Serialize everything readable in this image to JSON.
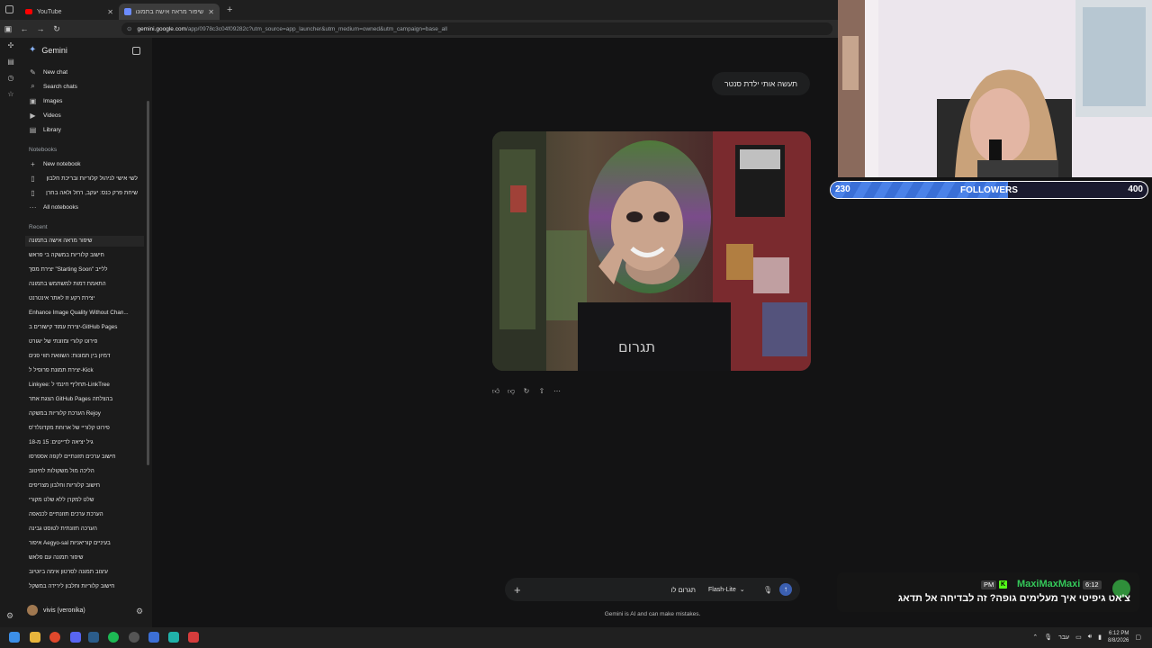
{
  "browser": {
    "tabs": [
      {
        "label": "YouTube",
        "active": false
      },
      {
        "label": "שיפור מראה אישה בתמונה - Ge",
        "active": true
      }
    ],
    "url_domain": "gemini.google.com",
    "url_path": "/app/0978c3c04f09282c?utm_source=app_launcher&utm_medium=owned&utm_campaign=base_all"
  },
  "sidebar": {
    "brand": "Gemini",
    "items": [
      {
        "label": "New chat",
        "icon": "edit-icon"
      },
      {
        "label": "Search chats",
        "icon": "search-icon"
      },
      {
        "label": "Images",
        "icon": "image-icon"
      },
      {
        "label": "Videos",
        "icon": "video-icon"
      },
      {
        "label": "Library",
        "icon": "library-icon"
      }
    ],
    "notebooks_heading": "Notebooks",
    "notebooks": [
      {
        "label": "New notebook",
        "icon": "plus-icon"
      },
      {
        "label": "לשי אישי לניהול קלוריות ובריכת חלבון",
        "icon": "notebook-icon"
      },
      {
        "label": "שיחת פרק כנס: יעקב, רחל ולאה בחרן",
        "icon": "notebook-icon"
      },
      {
        "label": "All notebooks",
        "icon": "more-icon"
      }
    ],
    "recent_heading": "Recent",
    "recent": [
      "שיפור מראה אישה בתמונה",
      "חישוב קלוריות במשקה בי פראש",
      "יצירת מסך \"Starting Soon\" ללייב",
      "התאמת דמות למשתמש בתמונה",
      "יצירת רקע זז לאתר אינטרנט",
      "Enhance Image Quality Without Chan...",
      "יצירת עמוד קישורים ב-GitHub Pages",
      "פירוט קלורי ומזונתי של יוגורט",
      "דמיון בין תמונות: השוואת תווי פנים",
      "יצירת תמונת פרופיל ל-Kick",
      "Linkyee: תחליף חינמי ל-LinkTree",
      "הצגת אתר GitHub Pages בהצלחה",
      "הערכת קלוריות במשקה Rejoy",
      "פירוט קלוריי של ארוחת מקדונלד'ס",
      "גיל יציאה לדייטים: 15 מ-18",
      "חישוב ערכים תזונתיים לקפה אספרסו",
      "הליכה מול משקולות לחיטוב",
      "חישוב קלוריות וחלבון מצריפים",
      "שלט למקרן ללא שלט מקורי",
      "הערכת ערכים תזונתיים לכנאפה",
      "הערכה תזונתית לטוסט גבינה",
      "איפור Aegyo-sal בעיניים קוריאניות",
      "שיפור תמונה עם פלאש",
      "עיצוב תמונה לסרטון אימה ביוטיוב",
      "חישוב קלוריות וחלבון לירידה במשקל"
    ],
    "user_name": "vivis (veronika)"
  },
  "main": {
    "prompt": "תעשה אותי ילדת סנטר",
    "image_alt": "punk girl with green and purple hair in graffiti alley",
    "composer_placeholder": "תגרום לו",
    "model": "Flash-Lite",
    "disclaimer": "Gemini is AI and can make mistakes."
  },
  "overlay": {
    "followers_label": "FOLLOWERS",
    "followers_min": "230",
    "followers_max": "400",
    "followers_progress": 0.56,
    "chat": {
      "time": "6:12",
      "name": "MaxiMaxMaxi",
      "badge": "PM",
      "message": "צ'אט גיפיטי איך מעלימים גופה? זה לבדיחה אל תדאג"
    }
  },
  "taskbar": {
    "lang": "עבר",
    "time": "6:12 PM",
    "date": "8/8/2026"
  }
}
